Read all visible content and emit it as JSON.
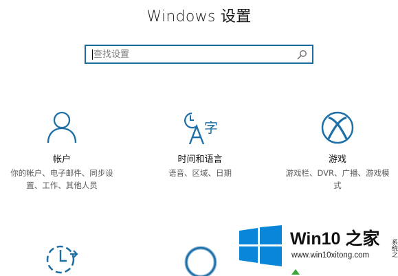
{
  "header": {
    "title": "Windows 设置"
  },
  "search": {
    "placeholder": "查找设置",
    "value": ""
  },
  "tiles": [
    {
      "title": "帐户",
      "desc": "你的帐户、电子邮件、同步设置、工作、其他人员",
      "icon": "person-icon"
    },
    {
      "title": "时间和语言",
      "desc": "语音、区域、日期",
      "icon": "time-language-icon"
    },
    {
      "title": "游戏",
      "desc": "游戏栏、DVR、广播、游戏模式",
      "icon": "xbox-icon"
    }
  ],
  "watermark": {
    "brand": "Win10 之家",
    "url": "www.win10xitong.com"
  },
  "edge": {
    "text": "系统之"
  },
  "colors": {
    "accent": "#1b6aa0",
    "icon": "#1e6fa6",
    "logo": "#0a86d8"
  }
}
